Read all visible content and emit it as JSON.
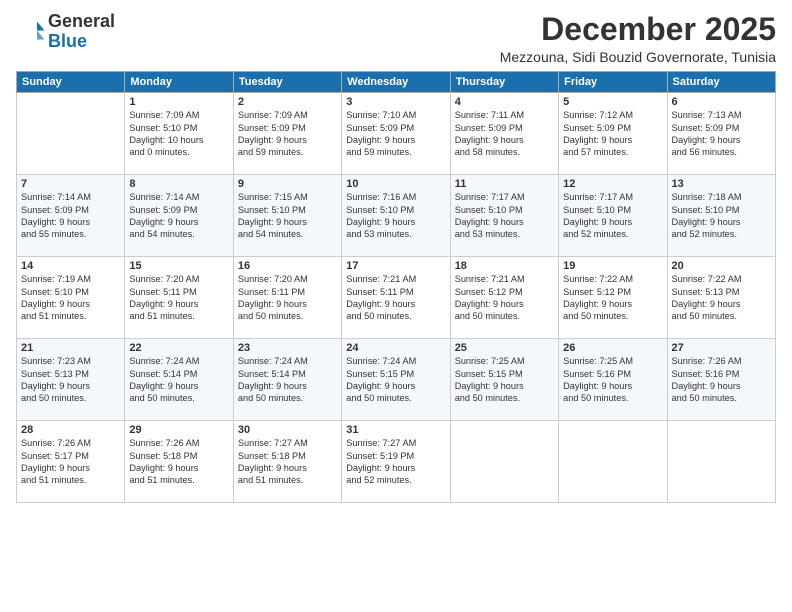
{
  "header": {
    "logo_general": "General",
    "logo_blue": "Blue",
    "month_title": "December 2025",
    "location": "Mezzouna, Sidi Bouzid Governorate, Tunisia"
  },
  "weekdays": [
    "Sunday",
    "Monday",
    "Tuesday",
    "Wednesday",
    "Thursday",
    "Friday",
    "Saturday"
  ],
  "weeks": [
    [
      {
        "day": "",
        "info": ""
      },
      {
        "day": "1",
        "info": "Sunrise: 7:09 AM\nSunset: 5:10 PM\nDaylight: 10 hours\nand 0 minutes."
      },
      {
        "day": "2",
        "info": "Sunrise: 7:09 AM\nSunset: 5:09 PM\nDaylight: 9 hours\nand 59 minutes."
      },
      {
        "day": "3",
        "info": "Sunrise: 7:10 AM\nSunset: 5:09 PM\nDaylight: 9 hours\nand 59 minutes."
      },
      {
        "day": "4",
        "info": "Sunrise: 7:11 AM\nSunset: 5:09 PM\nDaylight: 9 hours\nand 58 minutes."
      },
      {
        "day": "5",
        "info": "Sunrise: 7:12 AM\nSunset: 5:09 PM\nDaylight: 9 hours\nand 57 minutes."
      },
      {
        "day": "6",
        "info": "Sunrise: 7:13 AM\nSunset: 5:09 PM\nDaylight: 9 hours\nand 56 minutes."
      }
    ],
    [
      {
        "day": "7",
        "info": "Sunrise: 7:14 AM\nSunset: 5:09 PM\nDaylight: 9 hours\nand 55 minutes."
      },
      {
        "day": "8",
        "info": "Sunrise: 7:14 AM\nSunset: 5:09 PM\nDaylight: 9 hours\nand 54 minutes."
      },
      {
        "day": "9",
        "info": "Sunrise: 7:15 AM\nSunset: 5:10 PM\nDaylight: 9 hours\nand 54 minutes."
      },
      {
        "day": "10",
        "info": "Sunrise: 7:16 AM\nSunset: 5:10 PM\nDaylight: 9 hours\nand 53 minutes."
      },
      {
        "day": "11",
        "info": "Sunrise: 7:17 AM\nSunset: 5:10 PM\nDaylight: 9 hours\nand 53 minutes."
      },
      {
        "day": "12",
        "info": "Sunrise: 7:17 AM\nSunset: 5:10 PM\nDaylight: 9 hours\nand 52 minutes."
      },
      {
        "day": "13",
        "info": "Sunrise: 7:18 AM\nSunset: 5:10 PM\nDaylight: 9 hours\nand 52 minutes."
      }
    ],
    [
      {
        "day": "14",
        "info": "Sunrise: 7:19 AM\nSunset: 5:10 PM\nDaylight: 9 hours\nand 51 minutes."
      },
      {
        "day": "15",
        "info": "Sunrise: 7:20 AM\nSunset: 5:11 PM\nDaylight: 9 hours\nand 51 minutes."
      },
      {
        "day": "16",
        "info": "Sunrise: 7:20 AM\nSunset: 5:11 PM\nDaylight: 9 hours\nand 50 minutes."
      },
      {
        "day": "17",
        "info": "Sunrise: 7:21 AM\nSunset: 5:11 PM\nDaylight: 9 hours\nand 50 minutes."
      },
      {
        "day": "18",
        "info": "Sunrise: 7:21 AM\nSunset: 5:12 PM\nDaylight: 9 hours\nand 50 minutes."
      },
      {
        "day": "19",
        "info": "Sunrise: 7:22 AM\nSunset: 5:12 PM\nDaylight: 9 hours\nand 50 minutes."
      },
      {
        "day": "20",
        "info": "Sunrise: 7:22 AM\nSunset: 5:13 PM\nDaylight: 9 hours\nand 50 minutes."
      }
    ],
    [
      {
        "day": "21",
        "info": "Sunrise: 7:23 AM\nSunset: 5:13 PM\nDaylight: 9 hours\nand 50 minutes."
      },
      {
        "day": "22",
        "info": "Sunrise: 7:24 AM\nSunset: 5:14 PM\nDaylight: 9 hours\nand 50 minutes."
      },
      {
        "day": "23",
        "info": "Sunrise: 7:24 AM\nSunset: 5:14 PM\nDaylight: 9 hours\nand 50 minutes."
      },
      {
        "day": "24",
        "info": "Sunrise: 7:24 AM\nSunset: 5:15 PM\nDaylight: 9 hours\nand 50 minutes."
      },
      {
        "day": "25",
        "info": "Sunrise: 7:25 AM\nSunset: 5:15 PM\nDaylight: 9 hours\nand 50 minutes."
      },
      {
        "day": "26",
        "info": "Sunrise: 7:25 AM\nSunset: 5:16 PM\nDaylight: 9 hours\nand 50 minutes."
      },
      {
        "day": "27",
        "info": "Sunrise: 7:26 AM\nSunset: 5:16 PM\nDaylight: 9 hours\nand 50 minutes."
      }
    ],
    [
      {
        "day": "28",
        "info": "Sunrise: 7:26 AM\nSunset: 5:17 PM\nDaylight: 9 hours\nand 51 minutes."
      },
      {
        "day": "29",
        "info": "Sunrise: 7:26 AM\nSunset: 5:18 PM\nDaylight: 9 hours\nand 51 minutes."
      },
      {
        "day": "30",
        "info": "Sunrise: 7:27 AM\nSunset: 5:18 PM\nDaylight: 9 hours\nand 51 minutes."
      },
      {
        "day": "31",
        "info": "Sunrise: 7:27 AM\nSunset: 5:19 PM\nDaylight: 9 hours\nand 52 minutes."
      },
      {
        "day": "",
        "info": ""
      },
      {
        "day": "",
        "info": ""
      },
      {
        "day": "",
        "info": ""
      }
    ]
  ]
}
